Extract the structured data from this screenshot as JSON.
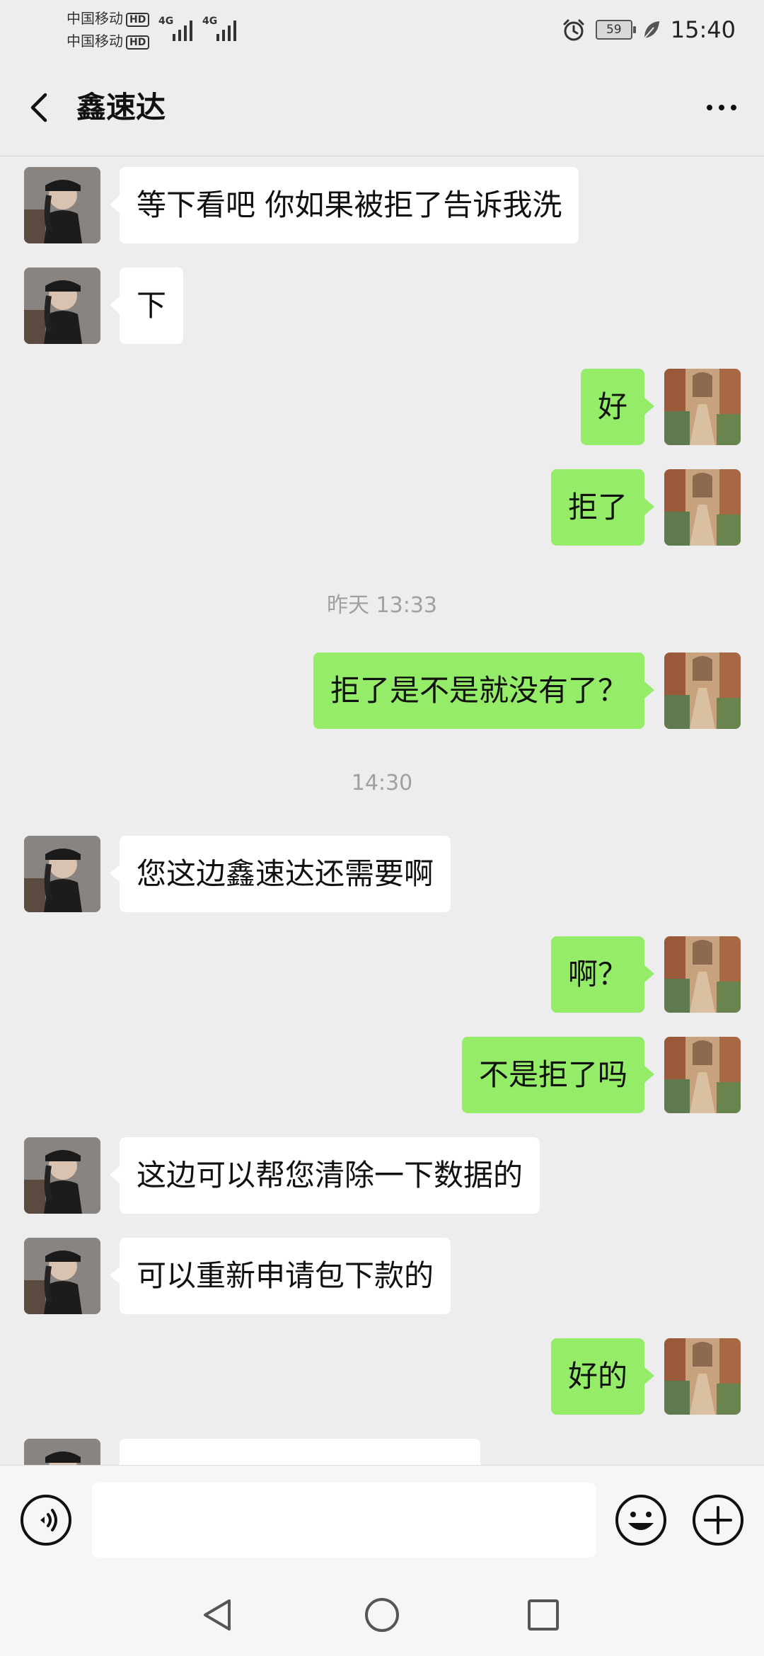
{
  "status_bar": {
    "carrier1": "中国移动",
    "carrier2": "中国移动",
    "hd_badge": "HD",
    "network_type": "4G",
    "battery": "59",
    "time": "15:40"
  },
  "header": {
    "title": "鑫速达"
  },
  "messages": [
    {
      "side": "left",
      "text": "等下看吧 你如果被拒了告诉我洗"
    },
    {
      "side": "left",
      "text": "下"
    },
    {
      "side": "right",
      "text": "好"
    },
    {
      "side": "right",
      "text": "拒了"
    },
    {
      "timestamp": "昨天 13:33"
    },
    {
      "side": "right",
      "text": "拒了是不是就没有了？"
    },
    {
      "timestamp": "14:30"
    },
    {
      "side": "left",
      "text": "您这边鑫速达还需要啊"
    },
    {
      "side": "right",
      "text": "啊？"
    },
    {
      "side": "right",
      "text": "不是拒了吗"
    },
    {
      "side": "left",
      "text": "这边可以帮您清除一下数据的"
    },
    {
      "side": "left",
      "text": "可以重新申请包下款的"
    },
    {
      "side": "right",
      "text": "好的"
    }
  ],
  "input": {
    "value": "",
    "placeholder": ""
  },
  "colors": {
    "background": "#ededed",
    "bubble_self": "#95ec69",
    "bubble_other": "#ffffff",
    "timestamp": "#a0a0a0"
  },
  "icons": {
    "back": "chevron-left-icon",
    "more": "more-dots-icon",
    "voice": "voice-icon",
    "emoji": "emoji-icon",
    "plus": "plus-icon",
    "alarm": "alarm-icon",
    "eco": "leaf-icon"
  }
}
